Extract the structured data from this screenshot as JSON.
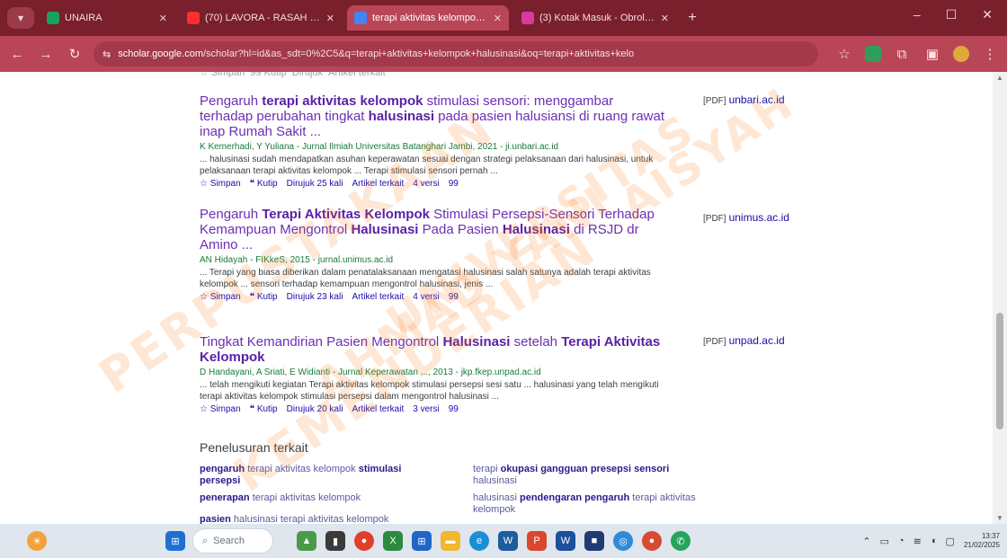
{
  "browser": {
    "tabs": [
      {
        "label": "UNAIRA",
        "color": "#18a05e",
        "active": false
      },
      {
        "label": "(70) LAVORA - RASAH BAL",
        "color": "#ff2d2d",
        "active": false
      },
      {
        "label": "terapi aktivitas kelompok halu...",
        "color": "#4285f4",
        "active": true
      },
      {
        "label": "(3) Kotak Masuk - Obrolan",
        "color": "#d93aa0",
        "active": false
      }
    ],
    "url_domain": "scholar.google.com",
    "url_path": "/scholar?hl=id&as_sdt=0%2C5&q=terapi+aktivitas+kelompok+halusinasi&oq=terapi+aktivitas+kelo"
  },
  "results": [
    {
      "title_parts": [
        {
          "t": "Pengaruh ",
          "b": false
        },
        {
          "t": "terapi aktivitas kelompok",
          "b": true
        },
        {
          "t": " stimulasi sensori: menggambar terhadap perubahan tingkat ",
          "b": false
        },
        {
          "t": "halusinasi",
          "b": true
        },
        {
          "t": " pada pasien halusiansi di ruang rawat inap Rumah Sakit ...",
          "b": false
        }
      ],
      "authors": "K Kemerhadi, Y Yuliana - Jurnal Ilmiah Universitas Batanghari Jambi, 2021 - ji.unbari.ac.id",
      "snippet": "... halusinasi sudah mendapatkan asuhan keperawatan sesuai dengan strategi pelaksanaan dari halusinasi, untuk pelaksanaan terapi aktivitas kelompok ... Terapi stimulasi sensori pernah ...",
      "cited": "Dirujuk 25 kali",
      "versions": "4 versi",
      "pdf_host": "unbari.ac.id"
    },
    {
      "title_parts": [
        {
          "t": "Pengaruh ",
          "b": false
        },
        {
          "t": "Terapi Aktivitas Kelompok",
          "b": true
        },
        {
          "t": " Stimulasi Persepsi-Sensori Terhadap Kemampuan Mengontrol ",
          "b": false
        },
        {
          "t": "Halusinasi",
          "b": true
        },
        {
          "t": " Pada Pasien ",
          "b": false
        },
        {
          "t": "Halusinasi",
          "b": true
        },
        {
          "t": " di RSJD dr Amino ...",
          "b": false
        }
      ],
      "authors": "AN Hidayah - FIKkeS, 2015 - jurnal.unimus.ac.id",
      "snippet": "... Terapi yang biasa diberikan dalam penatalaksanaan mengatasi halusinasi salah satunya adalah terapi aktivitas kelompok ... sensori terhadap kemampuan mengontrol halusinasi, jenis ...",
      "cited": "Dirujuk 23 kali",
      "versions": "4 versi",
      "pdf_host": "unimus.ac.id"
    },
    {
      "title_parts": [
        {
          "t": "Tingkat Kemandirian Pasien Mengontrol ",
          "b": false
        },
        {
          "t": "Halusinasi",
          "b": true
        },
        {
          "t": " setelah ",
          "b": false
        },
        {
          "t": "Terapi Aktivitas Kelompok",
          "b": true
        }
      ],
      "authors": "D Handayani, A Sriati, E Widianti - Jurnal Keperawatan ..., 2013 - jkp.fkep.unpad.ac.id",
      "snippet": "... telah mengikuti kegiatan Terapi aktivitas kelompok stimulasi persepsi sesi satu ... halusinasi yang telah mengikuti terapi aktivitas kelompok stimulasi persepsi dalam mengontrol halusinasi ...",
      "cited": "Dirujuk 20 kali",
      "versions": "3 versi",
      "pdf_host": "unpad.ac.id"
    }
  ],
  "actions": {
    "save": "Simpan",
    "cite": "Kutip",
    "related": "Artikel terkait",
    "bibtex": "99"
  },
  "pdf_tag": "[PDF]",
  "related_heading": "Penelusuran terkait",
  "related": [
    {
      "html": "<b>pengaruh</b> <span class='lt'>terapi aktivitas kelompok</span> <b>stimulasi persepsi</b>"
    },
    {
      "html": "<span class='lt'>terapi</span> <b>okupasi gangguan presepsi sensori</b> <span class='lt'>halusinasi</span>"
    },
    {
      "html": "<b>penerapan</b> <span class='lt'>terapi aktivitas kelompok</span>"
    },
    {
      "html": "<span class='lt'>halusinasi</span> <b>pendengaran pengaruh</b> <span class='lt'>terapi aktivitas kelompok</span>"
    },
    {
      "html": "<b>pasien</b> <span class='lt'>halusinasi terapi aktivitas kelompok</span>"
    }
  ],
  "watermark": [
    "PERPUSTAKAAN",
    "UNIVERSITAS",
    "AISYAH",
    "KEMENDERIAN",
    "AHMAD YANI"
  ],
  "taskbar": {
    "search_placeholder": "Search",
    "time": "13:37",
    "date": "21/02/2025"
  }
}
